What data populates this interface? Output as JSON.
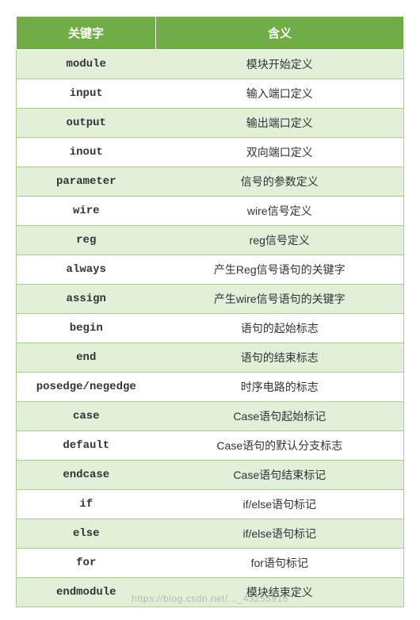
{
  "headers": {
    "keyword": "关键字",
    "meaning": "含义"
  },
  "rows": [
    {
      "keyword": "module",
      "meaning": "模块开始定义"
    },
    {
      "keyword": "input",
      "meaning": "输入端口定义"
    },
    {
      "keyword": "output",
      "meaning": "输出端口定义"
    },
    {
      "keyword": "inout",
      "meaning": "双向端口定义"
    },
    {
      "keyword": "parameter",
      "meaning": "信号的参数定义"
    },
    {
      "keyword": "wire",
      "meaning": "wire信号定义"
    },
    {
      "keyword": "reg",
      "meaning": "reg信号定义"
    },
    {
      "keyword": "always",
      "meaning": "产生Reg信号语句的关键字"
    },
    {
      "keyword": "assign",
      "meaning": "产生wire信号语句的关键字"
    },
    {
      "keyword": "begin",
      "meaning": "语句的起始标志"
    },
    {
      "keyword": "end",
      "meaning": "语句的结束标志"
    },
    {
      "keyword": "posedge/negedge",
      "meaning": "时序电路的标志"
    },
    {
      "keyword": "case",
      "meaning": "Case语句起始标记"
    },
    {
      "keyword": "default",
      "meaning": "Case语句的默认分支标志"
    },
    {
      "keyword": "endcase",
      "meaning": "Case语句结束标记"
    },
    {
      "keyword": "if",
      "meaning": "if/else语句标记"
    },
    {
      "keyword": "else",
      "meaning": "if/else语句标记"
    },
    {
      "keyword": "for",
      "meaning": "for语句标记"
    },
    {
      "keyword": "endmodule",
      "meaning": "模块结束定义"
    }
  ],
  "watermark": "https://blog.csdn.net/..._43255916"
}
